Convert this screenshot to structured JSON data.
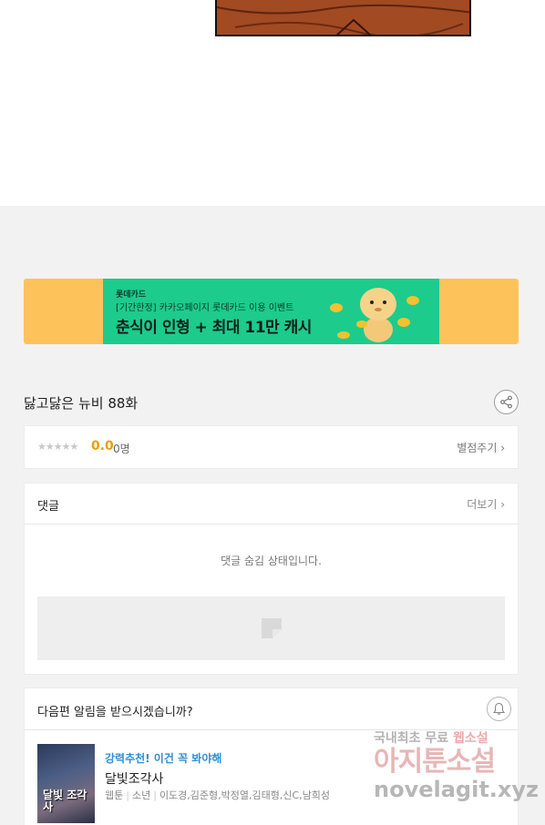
{
  "banner": {
    "brand": "롯데카드",
    "subtitle": "[기간한정] 카카오페이지 롯데카드 이용 이벤트",
    "title": "춘식이 인형 + 최대 11만 캐시",
    "colors": {
      "outer": "#fdc35a",
      "inner": "#1dcb8c"
    }
  },
  "episode": {
    "title": "닳고닳은 뉴비 88화"
  },
  "rating": {
    "stars": "★★★★★",
    "score": "0.0",
    "count": "0명",
    "rate_link": "별점주기 ›"
  },
  "comments": {
    "title": "댓글",
    "more": "더보기 ›",
    "hidden_message": "댓글 숨김 상태입니다."
  },
  "notify": {
    "question": "다음편 알림을 받으시겠습니까?",
    "recommendation": {
      "tag": "강력추천! 이건 꼭 봐야해",
      "title": "달빛조각사",
      "genre": "웹툰",
      "category": "소년",
      "authors": "이도경,김준형,박정열,김태형,신C,남희성",
      "thumbnail_text": "달빛 조각사"
    }
  },
  "watermark": {
    "line1_a": "국내최초 무료",
    "line1_b": "웹소설",
    "line2": "아지툰소설",
    "line3": "novelagit.xyz"
  }
}
